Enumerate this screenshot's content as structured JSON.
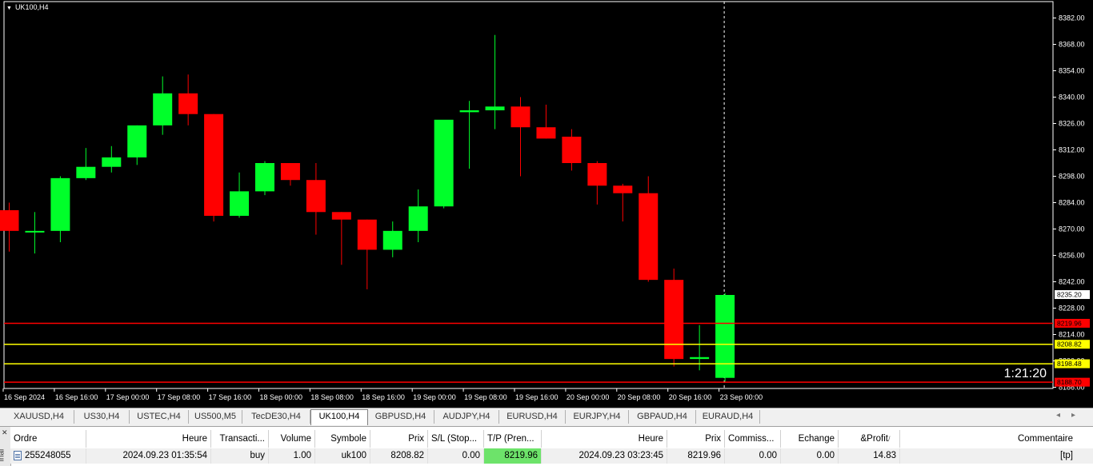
{
  "chart": {
    "symbol_label": "UK100,H4",
    "countdown": "1:21:20",
    "current_price_label": "8235.20",
    "colors": {
      "bull": "#00ff2a",
      "bear": "#ff0000",
      "background": "#000000",
      "grid_text": "#ffffff"
    }
  },
  "chart_data": {
    "type": "candlestick",
    "y_range": [
      8184,
      8387
    ],
    "y_ticks": [
      "8382.00",
      "8368.00",
      "8354.00",
      "8340.00",
      "8326.00",
      "8312.00",
      "8298.00",
      "8284.00",
      "8270.00",
      "8256.00",
      "8242.00",
      "8228.00",
      "8214.00",
      "8200.00",
      "8186.00"
    ],
    "x_labels": [
      "16 Sep 2024",
      "16 Sep 16:00",
      "17 Sep 00:00",
      "17 Sep 08:00",
      "17 Sep 16:00",
      "18 Sep 00:00",
      "18 Sep 08:00",
      "18 Sep 16:00",
      "19 Sep 00:00",
      "19 Sep 08:00",
      "19 Sep 16:00",
      "20 Sep 00:00",
      "20 Sep 08:00",
      "20 Sep 16:00",
      "23 Sep 00:00"
    ],
    "candles": [
      {
        "o": 8280,
        "h": 8284,
        "l": 8258,
        "c": 8269
      },
      {
        "o": 8269,
        "h": 8279,
        "l": 8257,
        "c": 8269
      },
      {
        "o": 8269,
        "h": 8298,
        "l": 8263,
        "c": 8297
      },
      {
        "o": 8297,
        "h": 8313,
        "l": 8296,
        "c": 8303
      },
      {
        "o": 8303,
        "h": 8314,
        "l": 8300,
        "c": 8308
      },
      {
        "o": 8308,
        "h": 8325,
        "l": 8304,
        "c": 8325
      },
      {
        "o": 8325,
        "h": 8351,
        "l": 8320,
        "c": 8342
      },
      {
        "o": 8342,
        "h": 8352,
        "l": 8325,
        "c": 8331
      },
      {
        "o": 8331,
        "h": 8331,
        "l": 8274,
        "c": 8277
      },
      {
        "o": 8277,
        "h": 8300,
        "l": 8276,
        "c": 8290
      },
      {
        "o": 8290,
        "h": 8306,
        "l": 8288,
        "c": 8305
      },
      {
        "o": 8305,
        "h": 8305,
        "l": 8293,
        "c": 8296
      },
      {
        "o": 8296,
        "h": 8305,
        "l": 8267,
        "c": 8279
      },
      {
        "o": 8279,
        "h": 8279,
        "l": 8251,
        "c": 8275
      },
      {
        "o": 8275,
        "h": 8275,
        "l": 8238,
        "c": 8259
      },
      {
        "o": 8259,
        "h": 8274,
        "l": 8255,
        "c": 8269
      },
      {
        "o": 8269,
        "h": 8291,
        "l": 8263,
        "c": 8282
      },
      {
        "o": 8282,
        "h": 8309,
        "l": 8281,
        "c": 8328
      },
      {
        "o": 8332,
        "h": 8338,
        "l": 8302,
        "c": 8333
      },
      {
        "o": 8333,
        "h": 8373,
        "l": 8323,
        "c": 8335
      },
      {
        "o": 8335,
        "h": 8340,
        "l": 8298,
        "c": 8324
      },
      {
        "o": 8324,
        "h": 8336,
        "l": 8318,
        "c": 8318
      },
      {
        "o": 8319,
        "h": 8323,
        "l": 8301,
        "c": 8305
      },
      {
        "o": 8305,
        "h": 8306,
        "l": 8283,
        "c": 8293
      },
      {
        "o": 8293,
        "h": 8294,
        "l": 8274,
        "c": 8289
      },
      {
        "o": 8289,
        "h": 8298,
        "l": 8242,
        "c": 8243
      },
      {
        "o": 8243,
        "h": 8249,
        "l": 8197,
        "c": 8201
      },
      {
        "o": 8201,
        "h": 8219,
        "l": 8195,
        "c": 8202
      },
      {
        "o": 8191,
        "h": 8236,
        "l": 8189,
        "c": 8235
      }
    ],
    "levels": [
      {
        "label": "8219.96",
        "value": 8219.96,
        "color": "#ff0000"
      },
      {
        "label": "8208.82",
        "value": 8208.82,
        "color": "#ffff00"
      },
      {
        "label": "8198.48",
        "value": 8198.48,
        "color": "#ffff00"
      },
      {
        "label": "8188.70",
        "value": 8188.7,
        "color": "#ff0000"
      }
    ]
  },
  "tabs": [
    "XAUUSD,H4",
    "US30,H4",
    "USTEC,H4",
    "US500,M5",
    "TecDE30,H4",
    "UK100,H4",
    "GBPUSD,H4",
    "AUDJPY,H4",
    "EURUSD,H4",
    "EURJPY,H4",
    "GBPAUD,H4",
    "EURAUD,H4"
  ],
  "active_tab": "UK100,H4",
  "terminal": {
    "side_label": "inal",
    "headers": [
      "Ordre",
      "Heure",
      "Transacti...",
      "Volume",
      "Symbole",
      "Prix",
      "S/L (Stop...",
      "T/P (Pren...",
      "Heure",
      "Prix",
      "Commiss...",
      "Echange",
      "&Profit",
      "Commentaire"
    ],
    "sort_mark": "/",
    "row": {
      "ordre": "255248055",
      "heure": "2024.09.23 01:35:54",
      "type": "buy",
      "volume": "1.00",
      "symbole": "uk100",
      "prix": "8208.82",
      "sl": "0.00",
      "tp": "8219.96",
      "heure2": "2024.09.23 03:23:45",
      "prix2": "8219.96",
      "commission": "0.00",
      "echange": "0.00",
      "profit": "14.83",
      "commentaire": "[tp]"
    }
  }
}
